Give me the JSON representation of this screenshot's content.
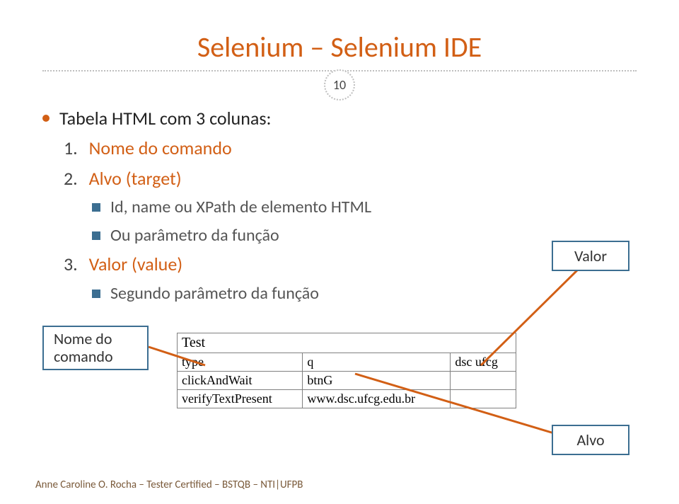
{
  "title": "Selenium – Selenium IDE",
  "page_number": "10",
  "main_bullet": "Tabela HTML com 3 colunas:",
  "items": [
    {
      "num": "1.",
      "label": "Nome do comando",
      "subs": []
    },
    {
      "num": "2.",
      "label": "Alvo (target)",
      "subs": [
        "Id, name ou XPath de elemento HTML",
        "Ou parâmetro da função"
      ]
    },
    {
      "num": "3.",
      "label": "Valor (value)",
      "subs": [
        "Segundo parâmetro da função"
      ]
    }
  ],
  "callouts": {
    "valor": "Valor",
    "nome": "Nome do comando",
    "alvo": "Alvo"
  },
  "table": {
    "header": "Test",
    "rows": [
      [
        "type",
        "q",
        "dsc ufcg"
      ],
      [
        "clickAndWait",
        "btnG",
        ""
      ],
      [
        "verifyTextPresent",
        "www.dsc.ufcg.edu.br",
        ""
      ]
    ]
  },
  "footer": "Anne Caroline O. Rocha – Tester Certified – BSTQB – NTI|UFPB"
}
